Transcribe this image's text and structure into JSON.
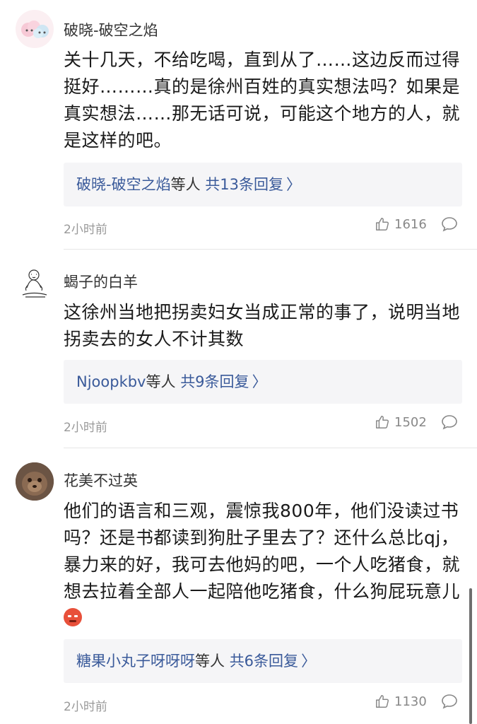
{
  "comments": [
    {
      "username": "破晓-破空之焰",
      "text": "关十几天，不给吃喝，直到从了……这边反而过得挺好………真的是徐州百姓的真实想法吗？如果是真实想法……那无话可说，可能这个地方的人，就是这样的吧。",
      "reply_names": "破晓-破空之焰",
      "reply_mid": "等人",
      "reply_count": "共13条回复",
      "time": "2小时前",
      "likes": "1616",
      "avatar_icon": "clouds-avatar-icon"
    },
    {
      "username": "蝎子的白羊",
      "text": "这徐州当地把拐卖妇女当成正常的事了，说明当地拐卖去的女人不计其数",
      "reply_names": "Njoopkbv",
      "reply_mid": "等人",
      "reply_count": "共9条回复",
      "time": "2小时前",
      "likes": "1502",
      "avatar_icon": "sketch-avatar-icon"
    },
    {
      "username": "花美不过英",
      "text": "他们的语言和三观，震惊我800年，他们没读过书吗？还是书都读到狗肚子里去了？还什么总比qj，暴力来的好，我可去他妈的吧，一个人吃猪食，就想去拉着全部人一起陪他吃猪食，什么狗屁玩意儿",
      "reply_names": "糖果小丸子呀呀呀",
      "reply_mid": "等人",
      "reply_count": "共6条回复",
      "time": "2小时前",
      "likes": "1130",
      "avatar_icon": "animal-photo-avatar-icon",
      "emoji_icon": "angry-face-emoji-icon"
    }
  ],
  "reply_chevron": "〉"
}
